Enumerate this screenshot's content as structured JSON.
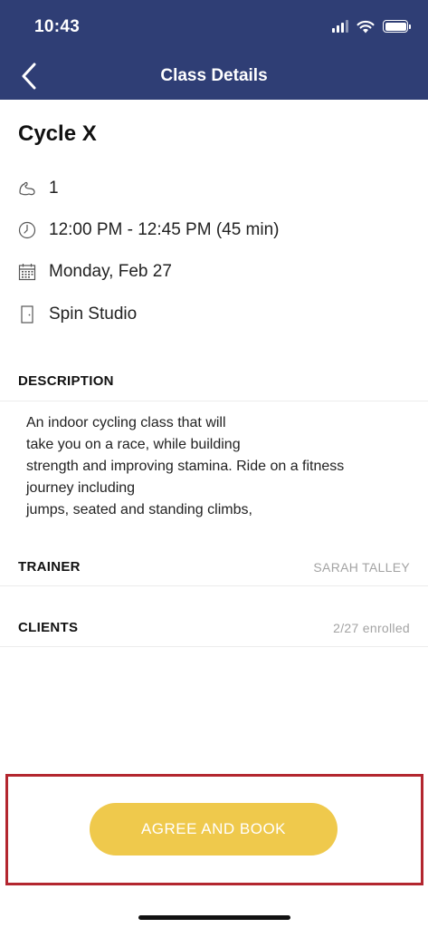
{
  "status_bar": {
    "time": "10:43"
  },
  "header": {
    "title": "Class Details"
  },
  "class": {
    "name": "Cycle X",
    "level": "1",
    "time": "12:00 PM - 12:45 PM (45 min)",
    "date": "Monday, Feb 27",
    "location": "Spin Studio"
  },
  "description": {
    "label": "DESCRIPTION",
    "lines": [
      "An indoor cycling class that will",
      "take you on a race, while building",
      "strength and improving stamina. Ride on a fitness",
      "journey including",
      "jumps, seated and standing climbs,"
    ]
  },
  "trainer": {
    "label": "TRAINER",
    "value": "SARAH  TALLEY"
  },
  "clients": {
    "label": "CLIENTS",
    "value": "2/27 enrolled"
  },
  "actions": {
    "book_label": "AGREE AND BOOK"
  },
  "colors": {
    "header_bg": "#2f3e75",
    "button_bg": "#efc94c",
    "highlight": "#b3262f"
  },
  "icons": [
    "back-chevron-icon",
    "muscle-icon",
    "clock-icon",
    "calendar-icon",
    "door-icon",
    "signal-icon",
    "wifi-icon",
    "battery-icon"
  ]
}
